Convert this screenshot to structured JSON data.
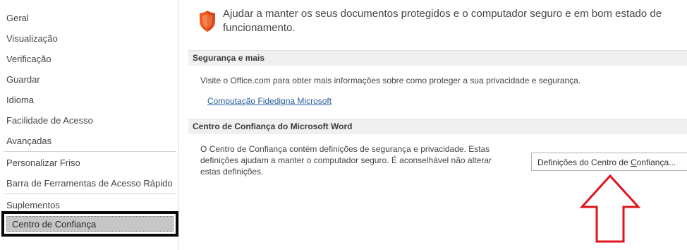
{
  "nav": {
    "items": [
      {
        "label": "Geral"
      },
      {
        "label": "Visualização"
      },
      {
        "label": "Verificação"
      },
      {
        "label": "Guardar"
      },
      {
        "label": "Idioma"
      },
      {
        "label": "Facilidade de Acesso"
      },
      {
        "label": "Avançadas"
      },
      {
        "label": "Personalizar Friso"
      },
      {
        "label": "Barra de Ferramentas de Acesso Rápido"
      },
      {
        "label": "Suplementos"
      },
      {
        "label": "Centro de Confiança"
      }
    ],
    "selected_index": 10
  },
  "content": {
    "intro_line1": "Ajudar a manter os seus documentos protegidos e o computador seguro e em bom estado de",
    "intro_line2": "funcionamento.",
    "security": {
      "header": "Segurança e mais",
      "text": "Visite o Office.com para obter mais informações sobre como proteger a sua privacidade e segurança.",
      "link": "Computação Fidedigna Microsoft"
    },
    "trust_center": {
      "header": "Centro de Confiança do Microsoft Word",
      "desc_line1": "O Centro de Confiança contém definições de segurança e privacidade. Estas",
      "desc_line2": "definições ajudam a manter o computador seguro. É aconselhável não alterar",
      "desc_line3": "estas definições.",
      "button_pre": "Definições do Centro de ",
      "button_access_key": "C",
      "button_post": "onfiança..."
    }
  },
  "colors": {
    "shield": "#f05a22",
    "arrow": "#e0141e",
    "link": "#2a5f9e",
    "selected_bg": "#c6c6c6"
  }
}
